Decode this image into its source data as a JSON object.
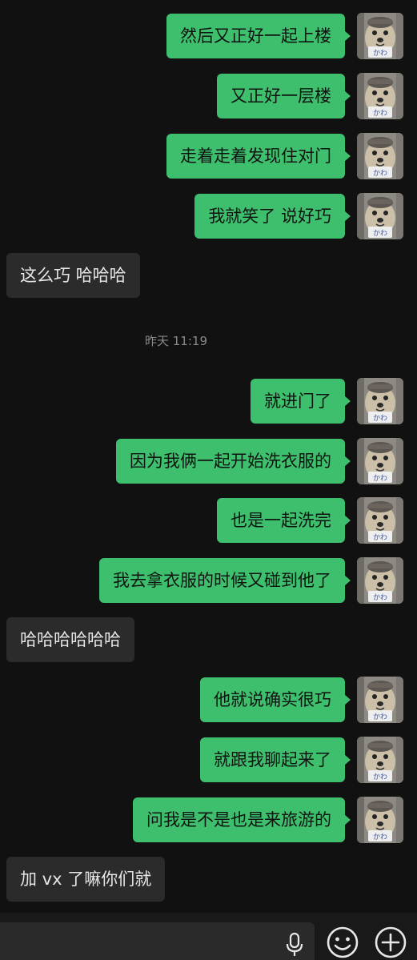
{
  "messages": [
    {
      "side": "out",
      "text": "然后又正好一起上楼"
    },
    {
      "side": "out",
      "text": "又正好一层楼"
    },
    {
      "side": "out",
      "text": "走着走着发现住对门"
    },
    {
      "side": "out",
      "text": "我就笑了 说好巧"
    },
    {
      "side": "in",
      "text": "这么巧 哈哈哈"
    },
    {
      "side": "out",
      "text": "就进门了"
    },
    {
      "side": "out",
      "text": "因为我俩一起开始洗衣服的"
    },
    {
      "side": "out",
      "text": "也是一起洗完"
    },
    {
      "side": "out",
      "text": "我去拿衣服的时候又碰到他了"
    },
    {
      "side": "in",
      "text": "哈哈哈哈哈哈"
    },
    {
      "side": "out",
      "text": "他就说确实很巧"
    },
    {
      "side": "out",
      "text": "就跟我聊起来了"
    },
    {
      "side": "out",
      "text": "问我是不是也是来旅游的"
    },
    {
      "side": "in",
      "text": "加 vx 了嘛你们就"
    }
  ],
  "timestamp": "昨天 11:19",
  "avatar": {
    "icon": "dog-avatar-icon",
    "tag_text": "かわ"
  },
  "input_bar": {
    "input_value": "",
    "mic_icon": "microphone-icon",
    "emoji_icon": "smiley-face-icon",
    "plus_icon": "plus-circle-icon"
  },
  "colors": {
    "background": "#111111",
    "outgoing_bubble": "#3ebf6e",
    "incoming_bubble": "#2b2b2b",
    "timestamp_text": "#8a8a8a",
    "input_bar": "#191919"
  }
}
